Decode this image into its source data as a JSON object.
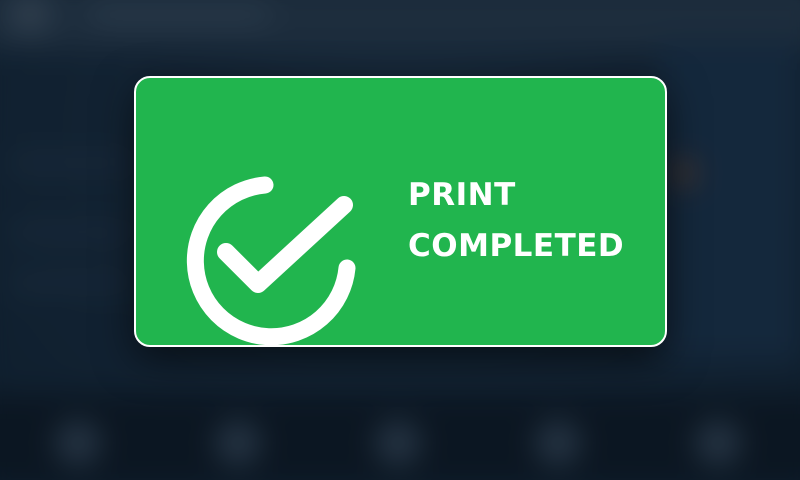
{
  "notification": {
    "line1": "PRINT",
    "line2": "COMPLETED",
    "icon": "check-circle-icon",
    "background_color": "#21b54e",
    "border_color": "#ffffff",
    "text_color": "#ffffff"
  }
}
